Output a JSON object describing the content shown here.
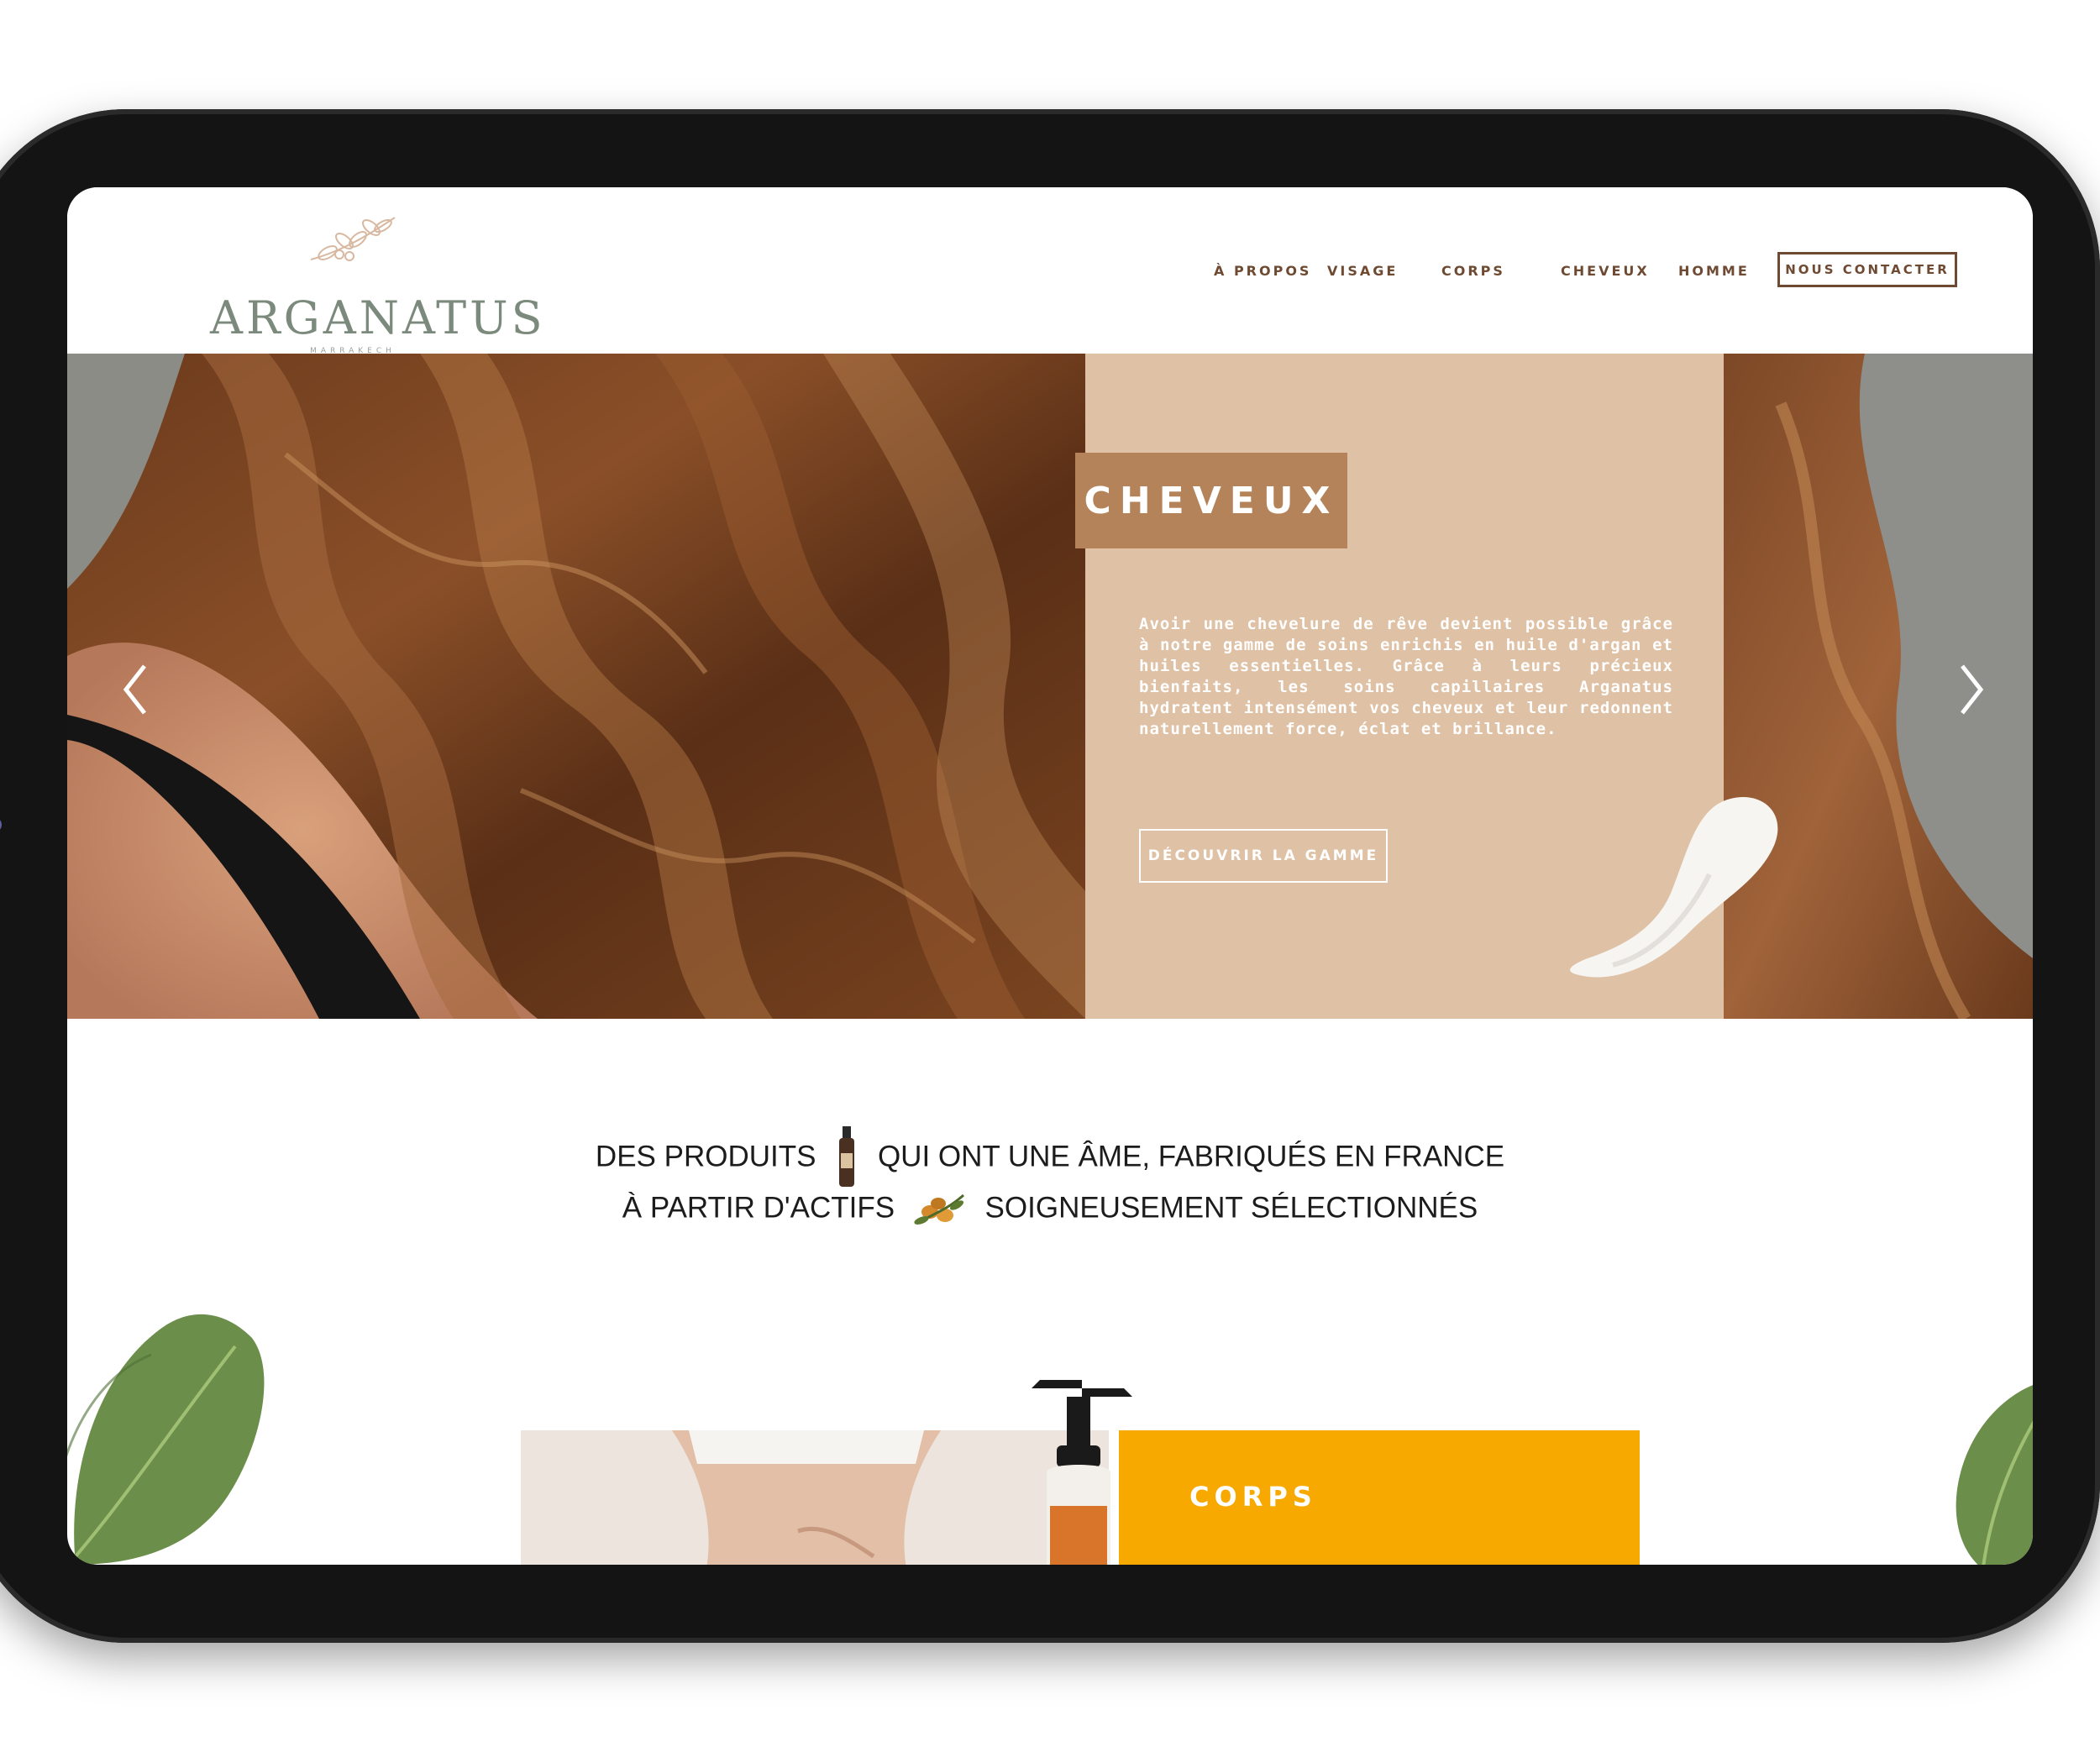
{
  "brand": {
    "name": "ARGANATUS",
    "city": "MARRAKECH"
  },
  "nav": {
    "items": [
      "À PROPOS",
      "VISAGE",
      "CORPS",
      "CHEVEUX",
      "HOMME"
    ],
    "contact": "NOUS CONTACTER"
  },
  "hero": {
    "title": "CHEVEUX",
    "description": "Avoir une chevelure de rêve devient possible grâce à notre gamme de soins enrichis en huile d'argan et huiles essentielles. Grâce à leurs précieux bienfaits, les soins capillaires Arganatus hydratent intensément vos cheveux et leur redonnent naturellement force, éclat et brillance.",
    "cta": "DÉCOUVRIR LA GAMME",
    "prev_icon": "chevron-left-icon",
    "next_icon": "chevron-right-icon"
  },
  "tagline": {
    "line1_a": "DES PRODUITS",
    "line1_b": "QUI ONT UNE ÂME, FABRIQUÉS EN FRANCE",
    "line2_a": "À PARTIR D'ACTIFS",
    "line2_b": "SOIGNEUSEMENT SÉLECTIONNÉS"
  },
  "corps": {
    "title": "CORPS"
  },
  "colors": {
    "accent_brown": "#6e4a32",
    "badge": "#b5835a",
    "panel": "#dfc1a5",
    "corps_panel": "#f8a900",
    "logo_green": "#7b8a7c"
  }
}
